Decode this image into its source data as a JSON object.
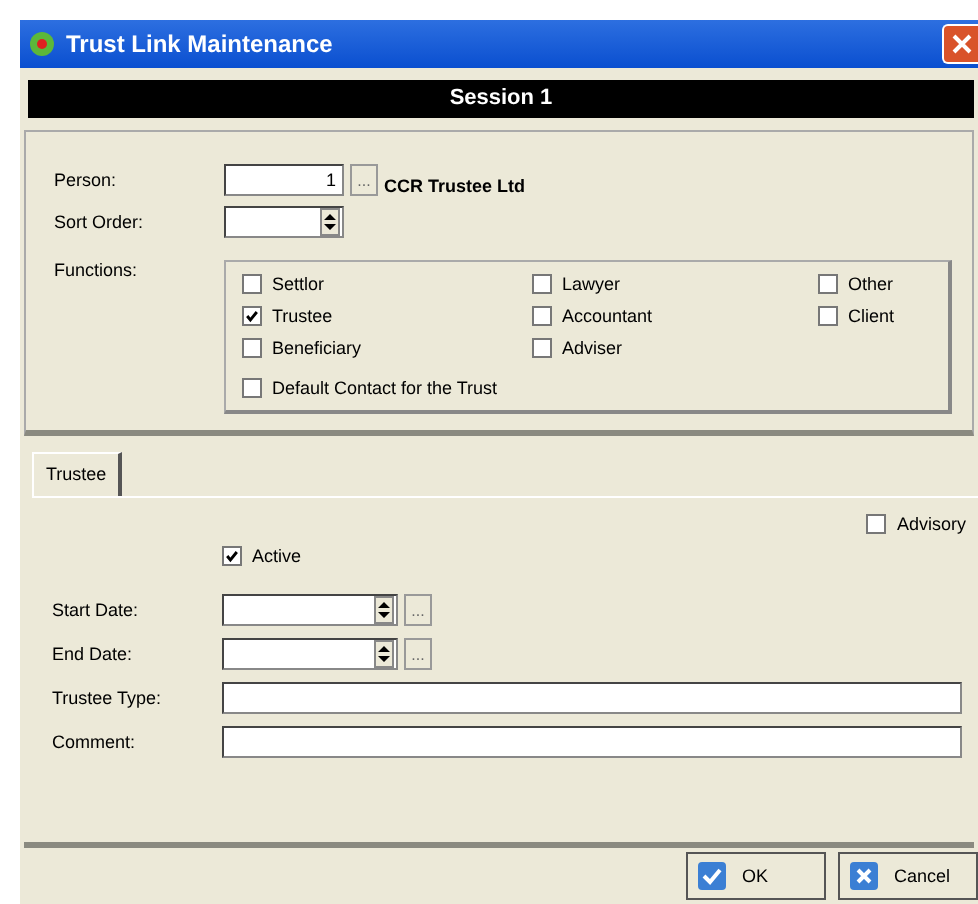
{
  "window": {
    "title": "Trust Link Maintenance"
  },
  "session": {
    "title": "Session 1"
  },
  "person": {
    "label": "Person:",
    "value": "1",
    "browse": "...",
    "name": "CCR Trustee Ltd"
  },
  "sort_order": {
    "label": "Sort Order:"
  },
  "functions": {
    "label": "Functions:",
    "items": [
      {
        "label": "Settlor",
        "checked": false
      },
      {
        "label": "Lawyer",
        "checked": false
      },
      {
        "label": "Other",
        "checked": false
      },
      {
        "label": "Trustee",
        "checked": true
      },
      {
        "label": "Accountant",
        "checked": false
      },
      {
        "label": "Client",
        "checked": false
      },
      {
        "label": "Beneficiary",
        "checked": false
      },
      {
        "label": "Adviser",
        "checked": false
      }
    ],
    "default_contact": {
      "label": "Default Contact for the Trust",
      "checked": false
    }
  },
  "tabs": [
    {
      "label": "Trustee",
      "selected": true
    }
  ],
  "trustee": {
    "advisory": {
      "label": "Advisory",
      "checked": false
    },
    "active": {
      "label": "Active",
      "checked": true
    },
    "start_date": {
      "label": "Start Date:",
      "browse": "..."
    },
    "end_date": {
      "label": "End Date:",
      "browse": "..."
    },
    "trustee_type": {
      "label": "Trustee Type:"
    },
    "comment": {
      "label": "Comment:"
    }
  },
  "buttons": [
    {
      "label": "OK",
      "kind": "ok"
    },
    {
      "label": "Cancel",
      "kind": "cancel"
    }
  ]
}
